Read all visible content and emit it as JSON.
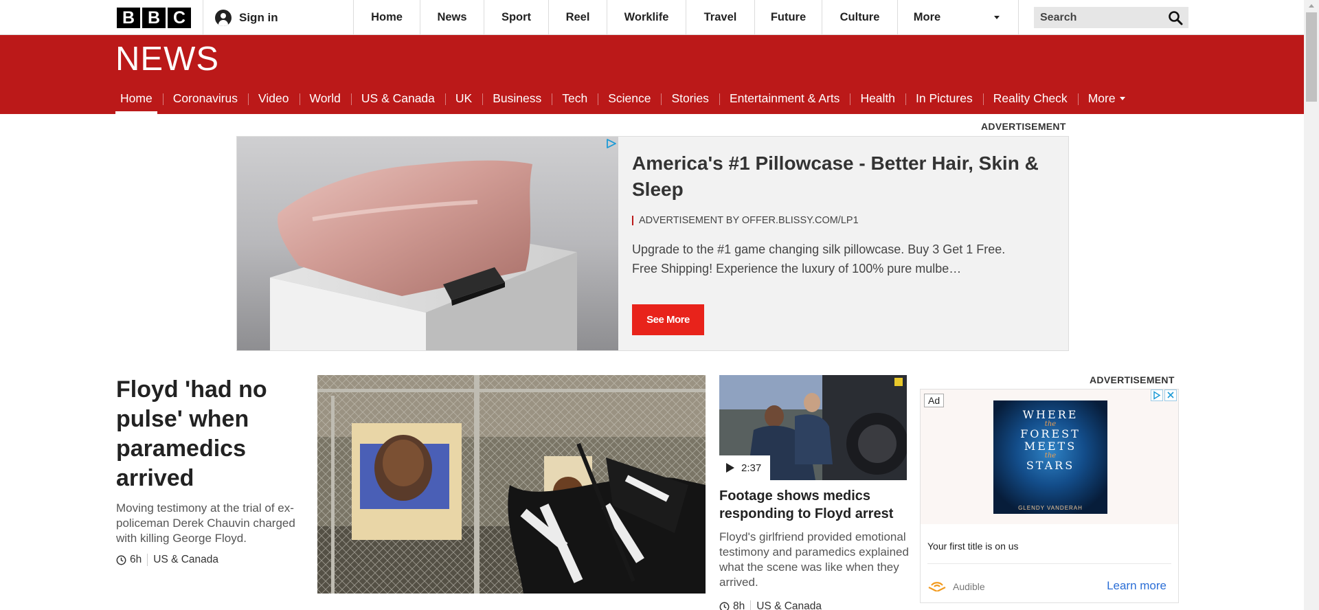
{
  "brand": {
    "letters": [
      "B",
      "B",
      "C"
    ]
  },
  "top_nav": {
    "sign_in": "Sign in",
    "items": [
      "Home",
      "News",
      "Sport",
      "Reel",
      "Worklife",
      "Travel",
      "Future",
      "Culture",
      "More"
    ],
    "search_placeholder": "Search"
  },
  "news_header": {
    "title": "NEWS",
    "nav": [
      "Home",
      "Coronavirus",
      "Video",
      "World",
      "US & Canada",
      "UK",
      "Business",
      "Tech",
      "Science",
      "Stories",
      "Entertainment & Arts",
      "Health",
      "In Pictures",
      "Reality Check",
      "More"
    ],
    "active": "Home"
  },
  "ad_top": {
    "label": "ADVERTISEMENT",
    "title": "America's #1 Pillowcase - Better Hair, Skin & Sleep",
    "source": "ADVERTISEMENT BY OFFER.BLISSY.COM/LP1",
    "description": "Upgrade to the #1 game changing silk pillowcase. Buy 3 Get 1 Free. Free Shipping! Experience the luxury of 100% pure mulbe…",
    "button": "See More"
  },
  "lead_story": {
    "headline": "Floyd 'had no pulse' when paramedics arrived",
    "summary": "Moving testimony at the trial of ex-policeman Derek Chauvin charged with killing George Floyd.",
    "time": "6h",
    "section": "US & Canada"
  },
  "second_story": {
    "duration": "2:37",
    "headline": "Footage shows medics responding to Floyd arrest",
    "summary": "Floyd's girlfriend provided emotional testimony and paramedics explained what the scene was like when they arrived.",
    "time": "8h",
    "section": "US & Canada"
  },
  "ad_side": {
    "label": "ADVERTISEMENT",
    "badge": "Ad",
    "book_title": [
      "WHERE",
      "the",
      "FOREST",
      "MEETS",
      "the",
      "STARS"
    ],
    "book_author": "GLENDY VANDERAH",
    "tagline": "Your first title is on us",
    "brand": "Audible",
    "cta": "Learn more"
  },
  "colors": {
    "brand_red": "#bb1919",
    "cta_red": "#e8231b",
    "link_blue": "#2b6ed6"
  }
}
